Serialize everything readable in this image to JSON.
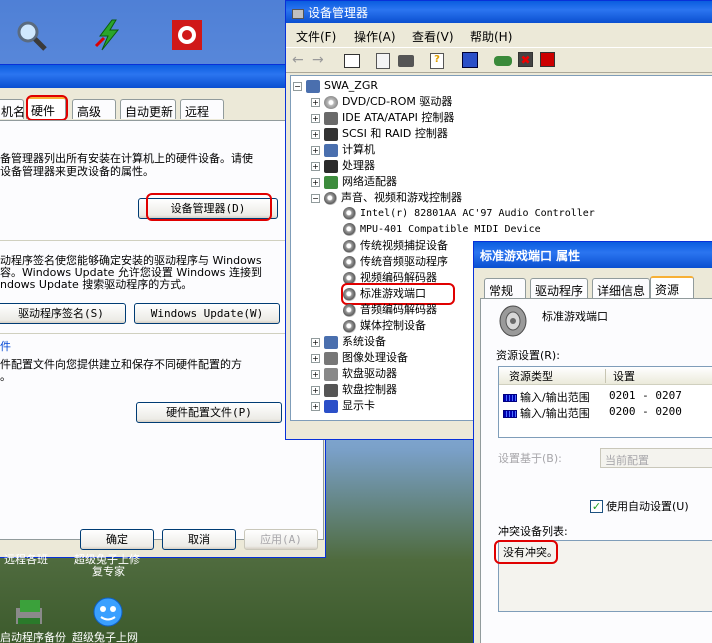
{
  "desktop_icons_bottom": [
    {
      "label_top": "远程各班",
      "label_bottom": ""
    },
    {
      "label_top": "超级兔子上修",
      "label_bottom": "复专家"
    },
    {
      "label_top": "启动程序备份",
      "label_bottom": ""
    },
    {
      "label_top": "超级兔子上网",
      "label_bottom": ""
    }
  ],
  "sysprops": {
    "tabs": [
      "机名",
      "硬件",
      "高级",
      "自动更新",
      "远程"
    ],
    "active_tab": "硬件",
    "devmgr_text1": "备管理器列出所有安装在计算机上的硬件设备。请使",
    "devmgr_text2": "设备管理器来更改设备的属性。",
    "devmgr_button": "设备管理器(D)",
    "driver_text1": "动程序签名使您能够确定安装的驱动程序与 Windows",
    "driver_text2": "容。Windows Update 允许您设置 Windows 连接到",
    "driver_text3": "ndows Update 搜索驱动程序的方式。",
    "driver_sign_button": "驱动程序签名(S)",
    "windows_update_button": "Windows Update(W)",
    "profile_heading": "件",
    "profile_text1": "件配置文件向您提供建立和保存不同硬件配置的方",
    "profile_text2": "。",
    "profile_button": "硬件配置文件(P)",
    "ok": "确定",
    "cancel": "取消",
    "apply": "应用(A)"
  },
  "devmgr": {
    "title": "设备管理器",
    "menu": [
      "文件(F)",
      "操作(A)",
      "查看(V)",
      "帮助(H)"
    ],
    "tree": [
      {
        "label": "SWA_ZGR",
        "level": 0,
        "exp": "-",
        "icon": "computer-icon"
      },
      {
        "label": "DVD/CD-ROM 驱动器",
        "level": 1,
        "exp": "+",
        "icon": "cdrom-icon"
      },
      {
        "label": "IDE ATA/ATAPI 控制器",
        "level": 1,
        "exp": "+",
        "icon": "ide-icon"
      },
      {
        "label": "SCSI 和 RAID 控制器",
        "level": 1,
        "exp": "+",
        "icon": "scsi-icon"
      },
      {
        "label": "计算机",
        "level": 1,
        "exp": "+",
        "icon": "computer-icon"
      },
      {
        "label": "处理器",
        "level": 1,
        "exp": "+",
        "icon": "cpu-icon"
      },
      {
        "label": "网络适配器",
        "level": 1,
        "exp": "+",
        "icon": "network-icon"
      },
      {
        "label": "声音、视频和游戏控制器",
        "level": 1,
        "exp": "-",
        "icon": "speaker-icon"
      },
      {
        "label": "Intel(r) 82801AA AC'97 Audio Controller",
        "level": 2,
        "exp": "",
        "icon": "speaker-icon"
      },
      {
        "label": "MPU-401 Compatible MIDI Device",
        "level": 2,
        "exp": "",
        "icon": "speaker-icon"
      },
      {
        "label": "传统视频捕捉设备",
        "level": 2,
        "exp": "",
        "icon": "speaker-icon"
      },
      {
        "label": "传统音频驱动程序",
        "level": 2,
        "exp": "",
        "icon": "speaker-icon"
      },
      {
        "label": "视频编码解码器",
        "level": 2,
        "exp": "",
        "icon": "speaker-icon"
      },
      {
        "label": "标准游戏端口",
        "level": 2,
        "exp": "",
        "icon": "speaker-icon"
      },
      {
        "label": "音频编码解码器",
        "level": 2,
        "exp": "",
        "icon": "speaker-icon"
      },
      {
        "label": "媒体控制设备",
        "level": 2,
        "exp": "",
        "icon": "speaker-icon"
      },
      {
        "label": "系统设备",
        "level": 1,
        "exp": "+",
        "icon": "system-icon"
      },
      {
        "label": "图像处理设备",
        "level": 1,
        "exp": "+",
        "icon": "camera-icon"
      },
      {
        "label": "软盘驱动器",
        "level": 1,
        "exp": "+",
        "icon": "floppy-icon"
      },
      {
        "label": "软盘控制器",
        "level": 1,
        "exp": "+",
        "icon": "floppy-controller-icon"
      },
      {
        "label": "显示卡",
        "level": 1,
        "exp": "+",
        "icon": "display-icon"
      }
    ]
  },
  "props": {
    "title": "标准游戏端口 属性",
    "tabs": [
      "常规",
      "驱动程序",
      "详细信息",
      "资源"
    ],
    "active_tab": "资源",
    "device_name": "标准游戏端口",
    "resource_settings_label": "资源设置(R):",
    "col_type": "资源类型",
    "col_setting": "设置",
    "resources": [
      {
        "type": "输入/输出范围",
        "setting": "0201 - 0207"
      },
      {
        "type": "输入/输出范围",
        "setting": "0200 - 0200"
      }
    ],
    "based_on_label": "设置基于(B):",
    "based_on_value": "当前配置",
    "auto_settings_label": "使用自动设置(U)",
    "auto_settings_checked": true,
    "conflict_label": "冲突设备列表:",
    "conflict_value": "没有冲突。"
  }
}
